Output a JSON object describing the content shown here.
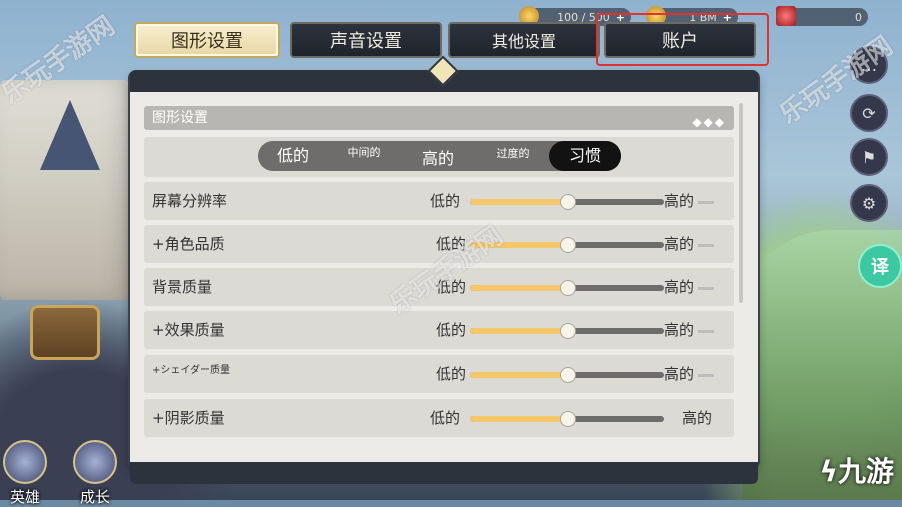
{
  "tabs": [
    {
      "label": "图形设置",
      "active": true
    },
    {
      "label": "声音设置",
      "active": false
    },
    {
      "label": "其他设置",
      "active": false
    },
    {
      "label": "账户",
      "active": false
    }
  ],
  "panel": {
    "section_title": "图形设置",
    "section_ornament": "◆◆◆",
    "presets": [
      {
        "label": "低的",
        "selected": false
      },
      {
        "label": "中间的",
        "selected": false
      },
      {
        "label": "高的",
        "selected": false
      },
      {
        "label": "过度的",
        "selected": false
      },
      {
        "label": "习惯",
        "selected": true
      }
    ],
    "settings": [
      {
        "label": "屏幕分辨率",
        "low": "低的",
        "high": "高的",
        "level": 0.5
      },
      {
        "label": "+角色品质",
        "low": "低的",
        "high": "高的",
        "level": 0.5
      },
      {
        "label": "背景质量",
        "low": "低的",
        "high": "高的",
        "level": 0.5
      },
      {
        "label": "+效果质量",
        "low": "低的",
        "high": "高的",
        "level": 0.5
      },
      {
        "label": "+シェイダー质量",
        "low": "低的",
        "high": "高的",
        "level": 0.5
      },
      {
        "label": "+阴影质量",
        "low": "低的",
        "high": "高的",
        "level": 0.5
      }
    ]
  },
  "currency": {
    "stamina": "100 / 500",
    "gold": "1 BM",
    "gems": "0"
  },
  "bottom_nav": [
    {
      "label": "英雄"
    },
    {
      "label": "成长"
    }
  ],
  "side_buttons": {
    "translate_label": "译"
  },
  "watermarks": {
    "left": "乐玩手游网",
    "center": "乐玩手游网",
    "right": "乐玩手游网",
    "logo": "九游"
  },
  "colors": {
    "accent": "#f3c76a",
    "tab_active_bg": "#f2e7c2",
    "highlight_border": "#e0322f",
    "translate_button": "#3cc8a0"
  }
}
